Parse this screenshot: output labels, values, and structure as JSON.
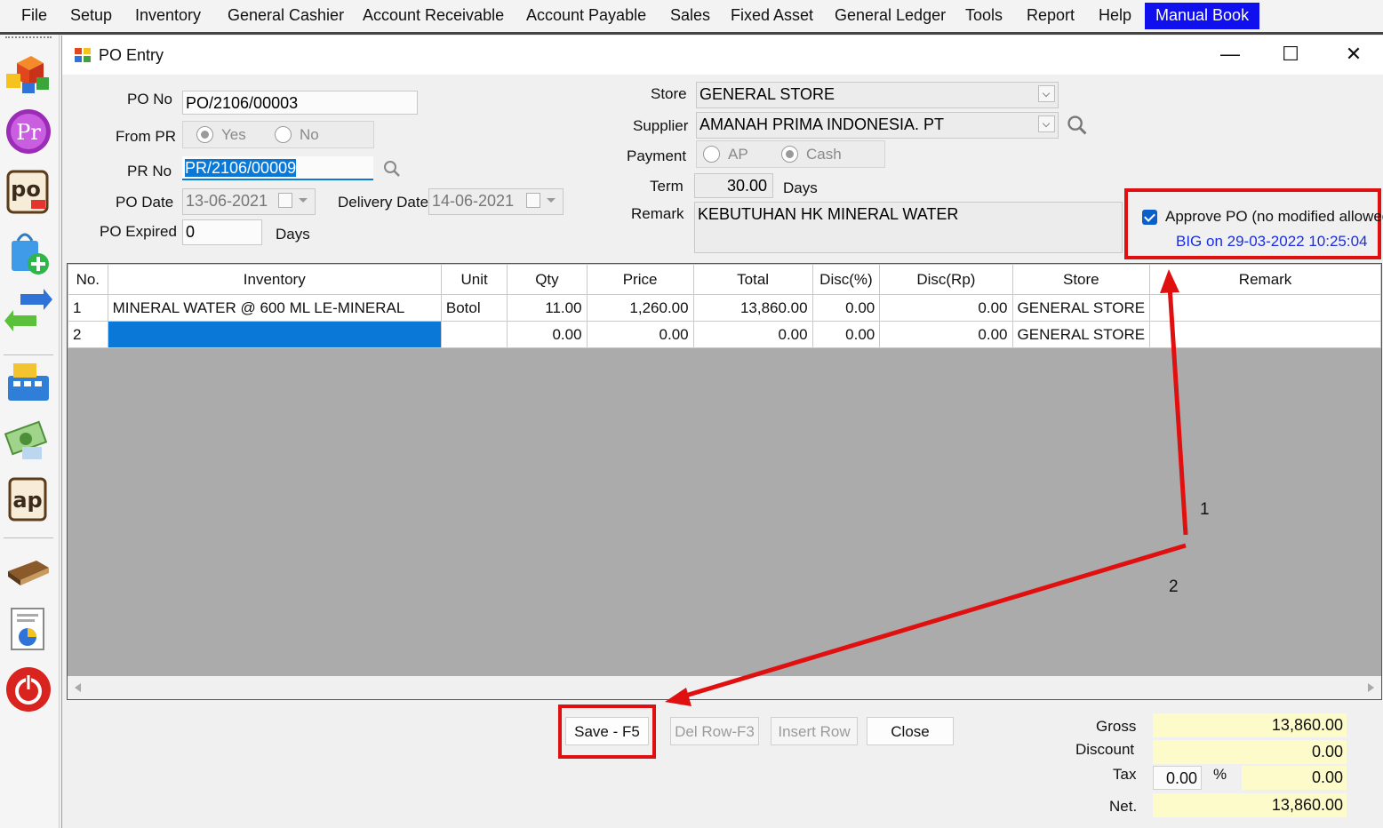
{
  "menu": {
    "items": [
      "File",
      "Setup",
      "Inventory",
      "General Cashier",
      "Account Receivable",
      "Account Payable",
      "Sales",
      "Fixed Asset",
      "General Ledger",
      "Tools",
      "Report",
      "Help"
    ],
    "active_item": "Manual Book"
  },
  "sidebar": {
    "icons": [
      "packages-icon",
      "pr-icon",
      "po-icon",
      "shopping-bag-add-icon",
      "transfer-arrows-icon",
      "cash-register-icon",
      "money-icon",
      "ap-icon",
      "book-icon",
      "report-chart-icon",
      "power-icon"
    ]
  },
  "window": {
    "title": "PO Entry",
    "minimize": "—",
    "maximize": "☐",
    "close": "✕"
  },
  "form": {
    "po_no_label": "PO No",
    "po_no": "PO/2106/00003",
    "from_pr_label": "From PR",
    "from_pr_yes": "Yes",
    "from_pr_no": "No",
    "pr_no_label": "PR No",
    "pr_no": "PR/2106/00009",
    "po_date_label": "PO Date",
    "po_date": "13-06-2021",
    "delivery_date_label": "Delivery Date",
    "delivery_date": "14-06-2021",
    "po_expired_label": "PO Expired",
    "po_expired": "0",
    "po_expired_unit": "Days",
    "store_label": "Store",
    "store": "GENERAL STORE",
    "supplier_label": "Supplier",
    "supplier": "AMANAH PRIMA INDONESIA. PT",
    "payment_label": "Payment",
    "payment_ap": "AP",
    "payment_cash": "Cash",
    "term_label": "Term",
    "term": "30.00",
    "term_unit": "Days",
    "remark_label": "Remark",
    "remark": "KEBUTUHAN HK MINERAL WATER"
  },
  "approve": {
    "label": "Approve PO (no modified allowed)",
    "checked": true,
    "info": "BIG on 29-03-2022 10:25:04"
  },
  "grid": {
    "columns": [
      "No.",
      "Inventory",
      "Unit",
      "Qty",
      "Price",
      "Total",
      "Disc(%)",
      "Disc(Rp)",
      "Store",
      "Remark"
    ],
    "rows": [
      {
        "no": "1",
        "inventory": "MINERAL WATER @ 600 ML LE-MINERAL",
        "unit": "Botol",
        "qty": "11.00",
        "price": "1,260.00",
        "total": "13,860.00",
        "disc_pct": "0.00",
        "disc_rp": "0.00",
        "store": "GENERAL STORE",
        "remark": ""
      },
      {
        "no": "2",
        "inventory": "",
        "unit": "",
        "qty": "0.00",
        "price": "0.00",
        "total": "0.00",
        "disc_pct": "0.00",
        "disc_rp": "0.00",
        "store": "GENERAL STORE",
        "remark": ""
      }
    ]
  },
  "buttons": {
    "save": "Save - F5",
    "del_row": "Del Row-F3",
    "insert_row": "Insert Row",
    "close": "Close"
  },
  "totals": {
    "gross_label": "Gross",
    "gross": "13,860.00",
    "discount_label": "Discount",
    "discount": "0.00",
    "tax_label": "Tax",
    "tax_pct": "0.00",
    "tax_pct_symbol": "%",
    "tax": "0.00",
    "net_label": "Net.",
    "net": "13,860.00"
  },
  "annotations": {
    "step1": "1",
    "step2": "2",
    "color": "#e01010"
  }
}
